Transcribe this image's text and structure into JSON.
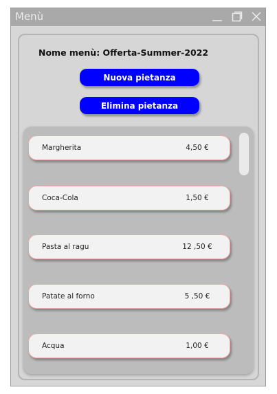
{
  "window": {
    "title": "Menù"
  },
  "panel": {
    "menu_name": "Nome menù: Offerta-Summer-2022",
    "new_dish_label": "Nuova pietanza",
    "delete_dish_label": "Elimina pietanza"
  },
  "items": [
    {
      "name": "Margherita",
      "price": "4,50 €"
    },
    {
      "name": "Coca-Cola",
      "price": "1,50 €"
    },
    {
      "name": "Pasta al ragu",
      "price": "12 ,50 €"
    },
    {
      "name": "Patate al forno",
      "price": "5 ,50 €"
    },
    {
      "name": "Acqua",
      "price": "1,00 €"
    }
  ],
  "colors": {
    "accent": "#0000ff",
    "item_border": "#e7a8a8"
  },
  "icons": [
    "minimize-icon",
    "maximize-icon",
    "close-icon"
  ]
}
